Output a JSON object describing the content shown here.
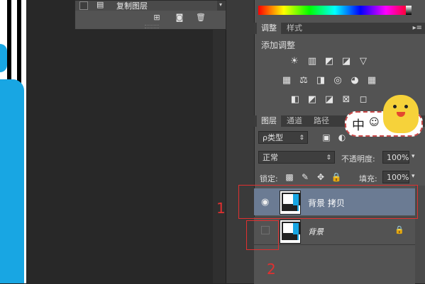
{
  "actions_panel": {
    "item_label": "复制图层",
    "tools": [
      "new-action-icon",
      "camera-icon",
      "trash-icon"
    ]
  },
  "adjustments": {
    "tabs": [
      "调整",
      "样式"
    ],
    "title": "添加调整",
    "icons_row1": [
      "☀",
      "▥",
      "◩",
      "◪",
      "▽"
    ],
    "icons_row2": [
      "▦",
      "⚖",
      "◨",
      "◎",
      "◕",
      "▦"
    ],
    "icons_row3": [
      "◧",
      "◩",
      "◪",
      "⊠",
      "◻"
    ]
  },
  "layers_panel": {
    "tabs": [
      "图层",
      "通道",
      "路径"
    ],
    "filter_label": "ρ类型",
    "blend_mode": "正常",
    "opacity_label": "不透明度:",
    "opacity_value": "100%",
    "lock_label": "锁定:",
    "fill_label": "填充:",
    "fill_value": "100%",
    "layers": [
      {
        "name": "背景 拷贝",
        "visible": true,
        "selected": true
      },
      {
        "name": "背景",
        "visible": false,
        "selected": false,
        "locked": true
      }
    ]
  },
  "annotations": {
    "num1": "1",
    "num2": "2",
    "red_color": "#e03030"
  },
  "sticker": {
    "glyph": "中"
  }
}
